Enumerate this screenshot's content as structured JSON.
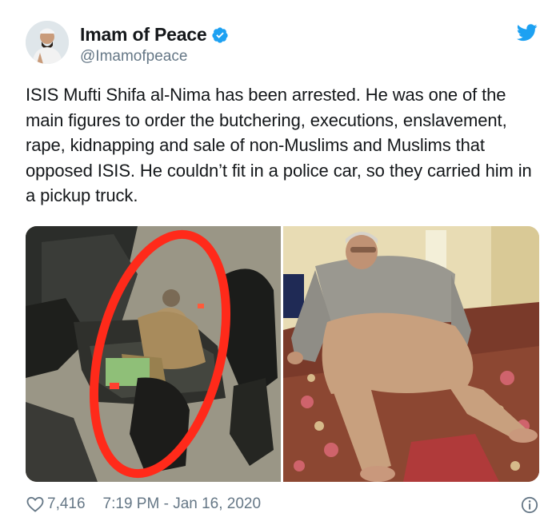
{
  "author": {
    "display_name": "Imam of Peace",
    "handle": "@Imamofpeace",
    "verified": true,
    "avatar_icon": "avatar-photo"
  },
  "brand": {
    "icon": "twitter-bird-icon",
    "color": "#1da1f2"
  },
  "tweet": {
    "text": "ISIS Mufti Shifa al-Nima has been arrested. He was one of the main figures to order the butchering, executions, enslavement, rape, kidnapping and sale of non-Muslims and Muslims that opposed ISIS. He couldn’t fit in a police car, so they carried him in a pickup truck."
  },
  "footer": {
    "like_icon": "heart-icon",
    "like_count": "7,416",
    "timestamp": "7:19 PM - Jan 16, 2020",
    "info_icon": "info-icon"
  },
  "colors": {
    "text_primary": "#14171a",
    "text_secondary": "#657786",
    "verified_blue": "#1da1f2",
    "highlight_red": "#ff2a1a"
  }
}
